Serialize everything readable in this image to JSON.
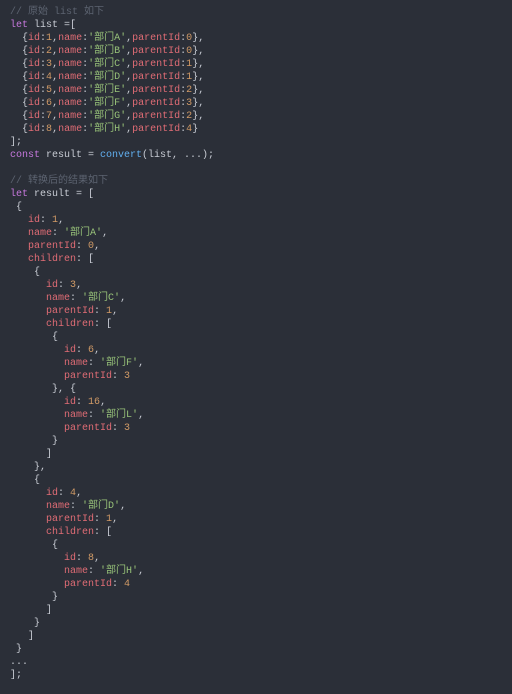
{
  "code": {
    "comment1": "// 原始 list 如下",
    "kw_let1": "let",
    "var_list": " list =[",
    "items": [
      {
        "open": "  {",
        "id_k": "id",
        "id_v": "1",
        "name_k": "name",
        "name_v": "'部门A'",
        "pid_k": "parentId",
        "pid_v": "0",
        "close": "},"
      },
      {
        "open": "  {",
        "id_k": "id",
        "id_v": "2",
        "name_k": "name",
        "name_v": "'部门B'",
        "pid_k": "parentId",
        "pid_v": "0",
        "close": "},"
      },
      {
        "open": "  {",
        "id_k": "id",
        "id_v": "3",
        "name_k": "name",
        "name_v": "'部门C'",
        "pid_k": "parentId",
        "pid_v": "1",
        "close": "},"
      },
      {
        "open": "  {",
        "id_k": "id",
        "id_v": "4",
        "name_k": "name",
        "name_v": "'部门D'",
        "pid_k": "parentId",
        "pid_v": "1",
        "close": "},"
      },
      {
        "open": "  {",
        "id_k": "id",
        "id_v": "5",
        "name_k": "name",
        "name_v": "'部门E'",
        "pid_k": "parentId",
        "pid_v": "2",
        "close": "},"
      },
      {
        "open": "  {",
        "id_k": "id",
        "id_v": "6",
        "name_k": "name",
        "name_v": "'部门F'",
        "pid_k": "parentId",
        "pid_v": "3",
        "close": "},"
      },
      {
        "open": "  {",
        "id_k": "id",
        "id_v": "7",
        "name_k": "name",
        "name_v": "'部门G'",
        "pid_k": "parentId",
        "pid_v": "2",
        "close": "},"
      },
      {
        "open": "  {",
        "id_k": "id",
        "id_v": "8",
        "name_k": "name",
        "name_v": "'部门H'",
        "pid_k": "parentId",
        "pid_v": "4",
        "close": "}"
      }
    ],
    "close_list": "];",
    "kw_const": "const",
    "var_result": " result = ",
    "fn_convert": "convert",
    "args": "(list, ...);",
    "blank": "",
    "comment2": "// 转换后的结果如下",
    "kw_let2": "let",
    "var_result2": " result = [",
    "body_lines": [
      " {",
      {
        "t": "prop",
        "pre": "   ",
        "k": "id",
        "sep": ": ",
        "v": "1",
        "vt": "num",
        "end": ","
      },
      {
        "t": "prop",
        "pre": "   ",
        "k": "name",
        "sep": ": ",
        "v": "'部门A'",
        "vt": "str",
        "end": ","
      },
      {
        "t": "prop",
        "pre": "   ",
        "k": "parentId",
        "sep": ": ",
        "v": "0",
        "vt": "num",
        "end": ","
      },
      {
        "t": "prop",
        "pre": "   ",
        "k": "children",
        "sep": ": [",
        "v": "",
        "vt": "",
        "end": ""
      },
      "    {",
      {
        "t": "prop",
        "pre": "      ",
        "k": "id",
        "sep": ": ",
        "v": "3",
        "vt": "num",
        "end": ","
      },
      {
        "t": "prop",
        "pre": "      ",
        "k": "name",
        "sep": ": ",
        "v": "'部门C'",
        "vt": "str",
        "end": ","
      },
      {
        "t": "prop",
        "pre": "      ",
        "k": "parentId",
        "sep": ": ",
        "v": "1",
        "vt": "num",
        "end": ","
      },
      {
        "t": "prop",
        "pre": "      ",
        "k": "children",
        "sep": ": [",
        "v": "",
        "vt": "",
        "end": ""
      },
      "       {",
      {
        "t": "prop",
        "pre": "         ",
        "k": "id",
        "sep": ": ",
        "v": "6",
        "vt": "num",
        "end": ","
      },
      {
        "t": "prop",
        "pre": "         ",
        "k": "name",
        "sep": ": ",
        "v": "'部门F'",
        "vt": "str",
        "end": ","
      },
      {
        "t": "prop",
        "pre": "         ",
        "k": "parentId",
        "sep": ": ",
        "v": "3",
        "vt": "num",
        "end": ""
      },
      "       }, {",
      {
        "t": "prop",
        "pre": "         ",
        "k": "id",
        "sep": ": ",
        "v": "16",
        "vt": "num",
        "end": ","
      },
      {
        "t": "prop",
        "pre": "         ",
        "k": "name",
        "sep": ": ",
        "v": "'部门L'",
        "vt": "str",
        "end": ","
      },
      {
        "t": "prop",
        "pre": "         ",
        "k": "parentId",
        "sep": ": ",
        "v": "3",
        "vt": "num",
        "end": ""
      },
      "       }",
      "      ]",
      "    },",
      "    {",
      {
        "t": "prop",
        "pre": "      ",
        "k": "id",
        "sep": ": ",
        "v": "4",
        "vt": "num",
        "end": ","
      },
      {
        "t": "prop",
        "pre": "      ",
        "k": "name",
        "sep": ": ",
        "v": "'部门D'",
        "vt": "str",
        "end": ","
      },
      {
        "t": "prop",
        "pre": "      ",
        "k": "parentId",
        "sep": ": ",
        "v": "1",
        "vt": "num",
        "end": ","
      },
      {
        "t": "prop",
        "pre": "      ",
        "k": "children",
        "sep": ": [",
        "v": "",
        "vt": "",
        "end": ""
      },
      "       {",
      {
        "t": "prop",
        "pre": "         ",
        "k": "id",
        "sep": ": ",
        "v": "8",
        "vt": "num",
        "end": ","
      },
      {
        "t": "prop",
        "pre": "         ",
        "k": "name",
        "sep": ": ",
        "v": "'部门H'",
        "vt": "str",
        "end": ","
      },
      {
        "t": "prop",
        "pre": "         ",
        "k": "parentId",
        "sep": ": ",
        "v": "4",
        "vt": "num",
        "end": ""
      },
      "       }",
      "      ]",
      "    }",
      "   ]",
      " }",
      "...",
      "];"
    ]
  }
}
